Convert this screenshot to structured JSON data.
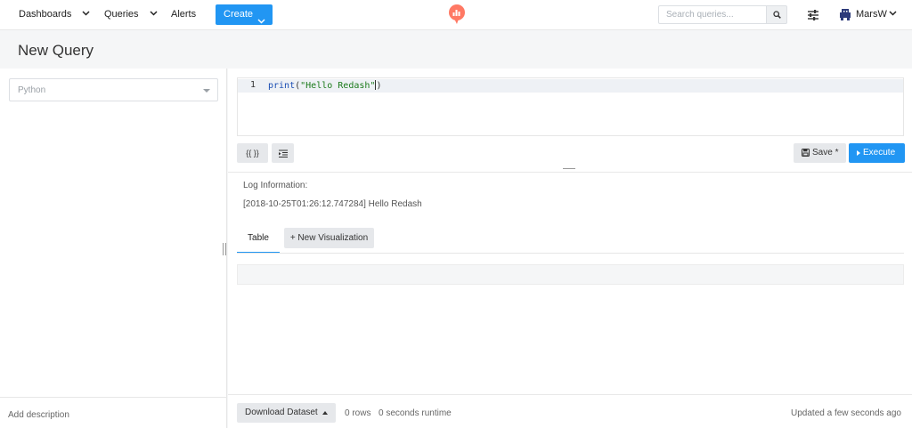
{
  "nav": {
    "dashboards": "Dashboards",
    "queries": "Queries",
    "alerts": "Alerts",
    "create": "Create",
    "search_placeholder": "Search queries...",
    "username": "MarsW"
  },
  "colors": {
    "accent": "#2196f3",
    "logo": "#ff7964"
  },
  "page": {
    "title": "New Query"
  },
  "sidebar": {
    "datasource": "Python",
    "add_description": "Add description"
  },
  "editor": {
    "line_number": "1",
    "code_keyword": "print",
    "code_open": "(",
    "code_string": "\"Hello Redash\"",
    "code_close": ")"
  },
  "toolbar": {
    "params_label": "{{ }}",
    "save_label": "Save *",
    "execute_label": "Execute"
  },
  "log": {
    "label": "Log Information:",
    "line": "[2018-10-25T01:26:12.747284] Hello Redash"
  },
  "tabs": {
    "table": "Table",
    "new_visualization": "+ New Visualization"
  },
  "footer": {
    "download": "Download Dataset",
    "rows": "0 rows",
    "runtime": "0 seconds runtime",
    "updated": "Updated a few seconds ago"
  }
}
